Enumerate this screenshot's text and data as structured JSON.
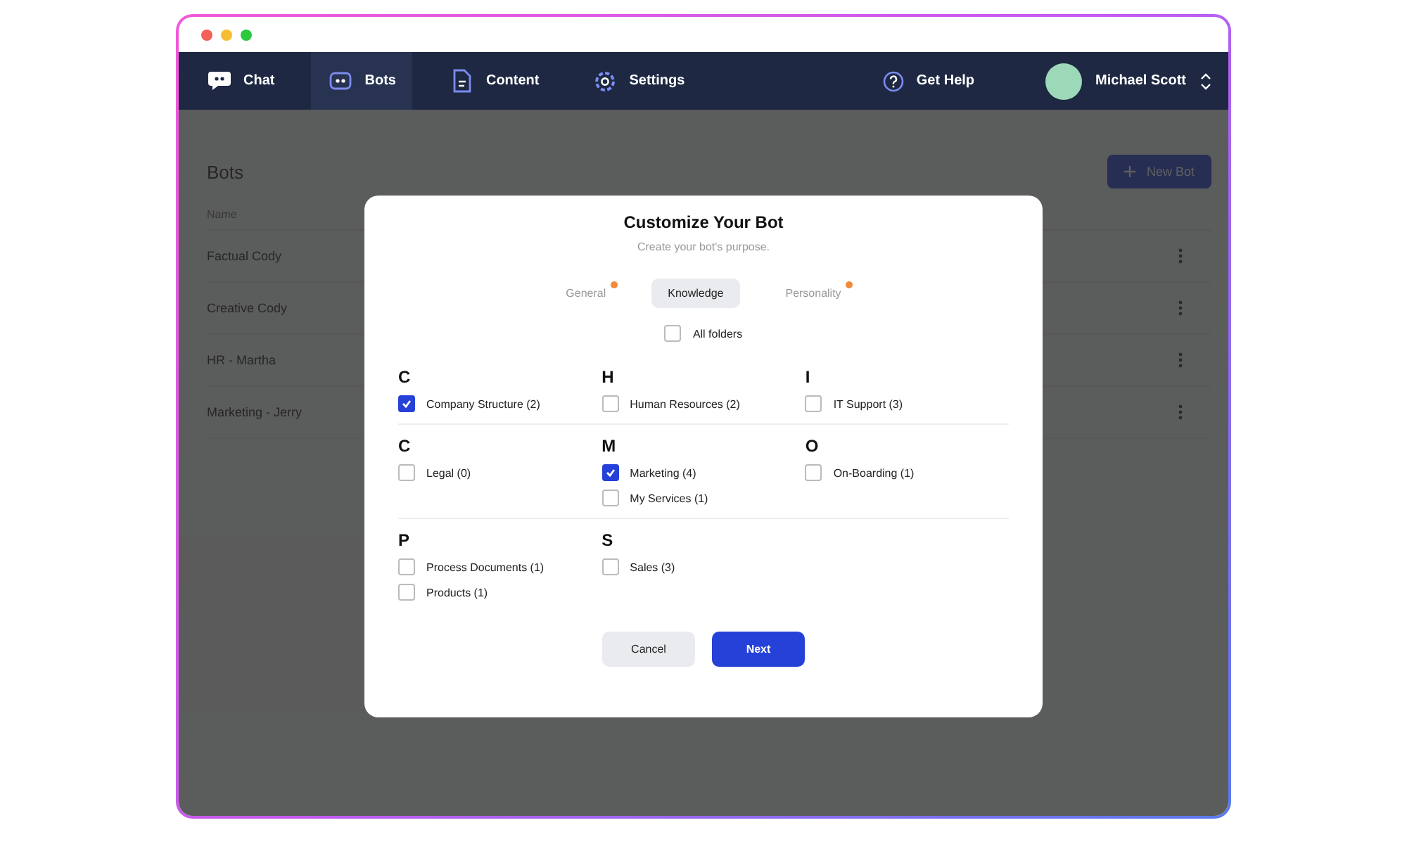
{
  "nav": {
    "items": [
      {
        "label": "Chat",
        "selected": false
      },
      {
        "label": "Bots",
        "selected": true
      },
      {
        "label": "Content",
        "selected": false
      },
      {
        "label": "Settings",
        "selected": false
      }
    ],
    "help": "Get Help",
    "user": "Michael Scott"
  },
  "page": {
    "title": "Bots",
    "new_button": "New Bot",
    "column": "Name",
    "rows": [
      "Factual Cody",
      "Creative Cody",
      "HR - Martha",
      "Marketing - Jerry"
    ]
  },
  "dialog": {
    "title": "Customize Your Bot",
    "subtitle": "Create your bot's purpose.",
    "tabs": [
      {
        "label": "General",
        "selected": false,
        "dot": true
      },
      {
        "label": "Knowledge",
        "selected": true,
        "dot": false
      },
      {
        "label": "Personality",
        "selected": false,
        "dot": true
      }
    ],
    "all_folders": {
      "label": "All folders",
      "checked": false
    },
    "group_rows": [
      [
        {
          "letter": "C",
          "items": [
            {
              "label": "Company Structure (2)",
              "checked": true
            }
          ]
        },
        {
          "letter": "H",
          "items": [
            {
              "label": "Human Resources (2)",
              "checked": false
            }
          ]
        },
        {
          "letter": "I",
          "items": [
            {
              "label": "IT Support (3)",
              "checked": false
            }
          ]
        }
      ],
      [
        {
          "letter": "C",
          "items": [
            {
              "label": "Legal (0)",
              "checked": false
            }
          ]
        },
        {
          "letter": "M",
          "items": [
            {
              "label": "Marketing (4)",
              "checked": true
            },
            {
              "label": "My Services (1)",
              "checked": false
            }
          ]
        },
        {
          "letter": "O",
          "items": [
            {
              "label": "On-Boarding (1)",
              "checked": false
            }
          ]
        }
      ],
      [
        {
          "letter": "P",
          "items": [
            {
              "label": "Process Documents (1)",
              "checked": false
            },
            {
              "label": "Products (1)",
              "checked": false
            }
          ]
        },
        {
          "letter": "S",
          "items": [
            {
              "label": "Sales (3)",
              "checked": false
            }
          ]
        }
      ]
    ],
    "buttons": {
      "cancel": "Cancel",
      "next": "Next"
    }
  }
}
